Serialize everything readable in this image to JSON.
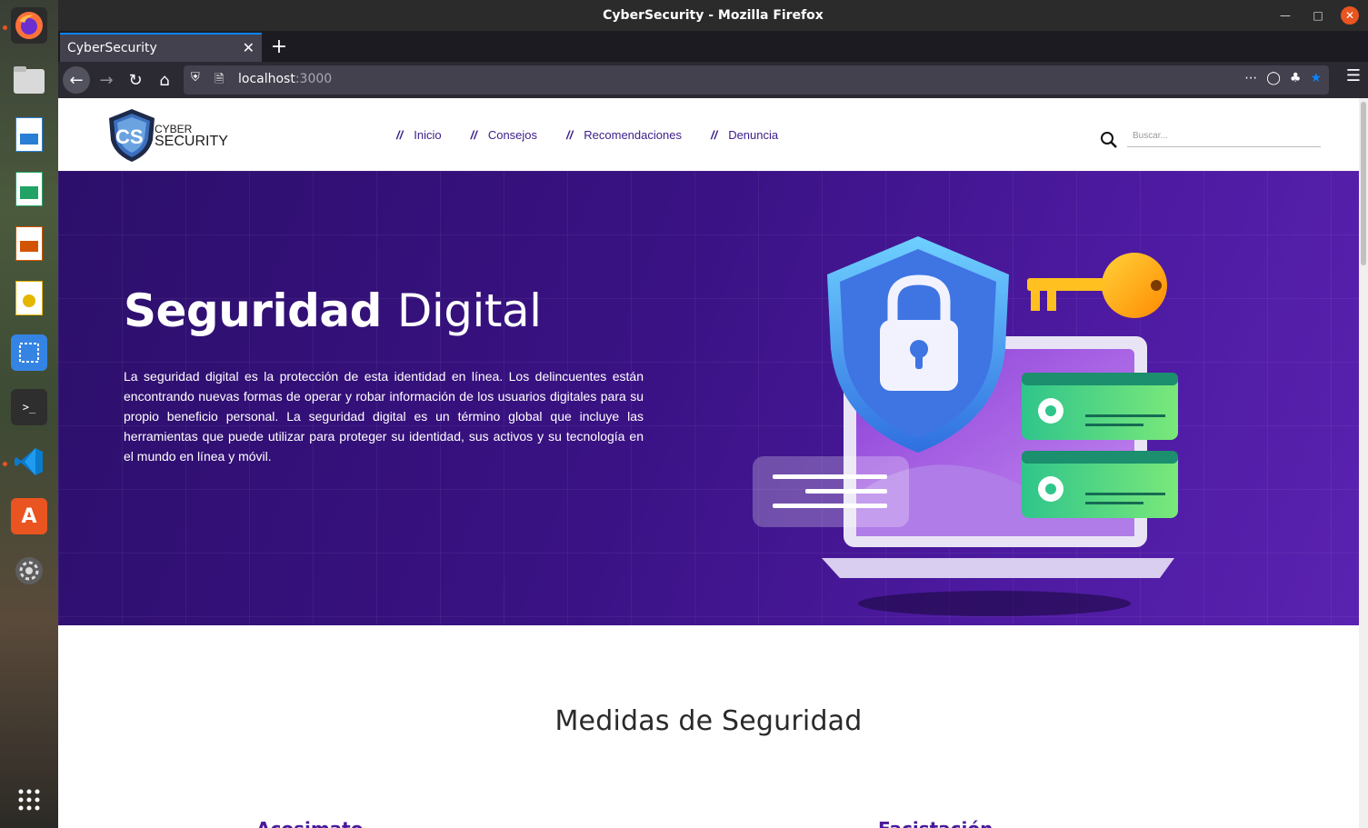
{
  "window": {
    "title": "CyberSecurity - Mozilla Firefox"
  },
  "browser": {
    "tab_title": "CyberSecurity",
    "url_host": "localhost",
    "url_port": ":3000"
  },
  "dock": {
    "items": [
      "firefox-icon",
      "files-icon",
      "writer-icon",
      "calc-icon",
      "impress-icon",
      "draw-icon",
      "screenshot-icon",
      "terminal-icon",
      "vscode-icon",
      "software-icon",
      "settings-icon",
      "apps-grid-icon"
    ]
  },
  "site": {
    "logo": {
      "initials": "CS",
      "line1": "CYBER",
      "line2": "SECURITY"
    },
    "menu": [
      {
        "slash": "//",
        "label": "Inicio"
      },
      {
        "slash": "//",
        "label": "Consejos"
      },
      {
        "slash": "//",
        "label": "Recomendaciones"
      },
      {
        "slash": "//",
        "label": "Denuncia"
      }
    ],
    "search_placeholder": "Buscar...",
    "hero": {
      "title_bold": "Seguridad",
      "title_light": "Digital",
      "text": "La seguridad digital es la protección de esta identidad en línea. Los delincuentes están encontrando nuevas formas de operar y robar información de los usuarios digitales para su propio beneficio personal. La seguridad digital es un término global que incluye las herramientas que puede utilizar para proteger su identidad, sus activos y su tecnología en el mundo en línea y móvil."
    },
    "section_title": "Medidas de Seguridad",
    "subheadings": [
      "Acosimato",
      "Facistación"
    ]
  },
  "colors": {
    "accent": "#3d1d8a",
    "hero_bg": "#3a1284",
    "firefox_blue": "#0a84ff",
    "ubuntu_orange": "#e95420"
  }
}
